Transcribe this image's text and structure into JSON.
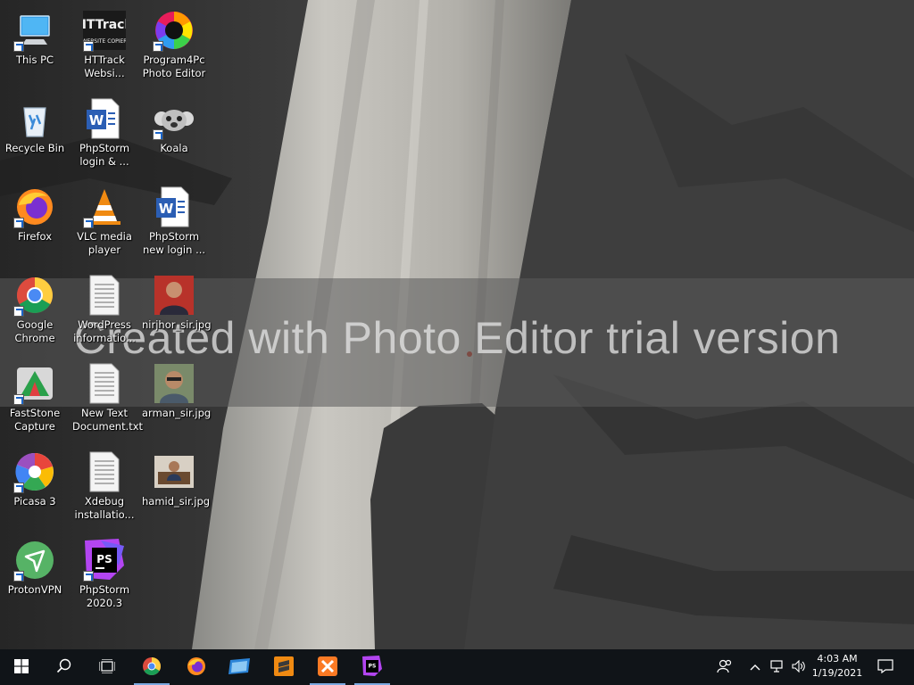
{
  "desktop": {
    "icons": [
      {
        "label": "This PC",
        "icon": "computer-icon"
      },
      {
        "label": "HTTrack Websi...",
        "icon": "httrack-icon",
        "logo_text": "HTTrack WEBSITE COPIER"
      },
      {
        "label": "Program4Pc Photo Editor",
        "icon": "photo-editor-icon"
      },
      {
        "label": "Recycle Bin",
        "icon": "recycle-bin-icon"
      },
      {
        "label": "PhpStorm login & ...",
        "icon": "word-document-icon"
      },
      {
        "label": "Koala",
        "icon": "koala-icon"
      },
      {
        "label": "Firefox",
        "icon": "firefox-icon"
      },
      {
        "label": "VLC media player",
        "icon": "vlc-icon"
      },
      {
        "label": "PhpStorm new login ...",
        "icon": "word-document-icon"
      },
      {
        "label": "Google Chrome",
        "icon": "chrome-icon"
      },
      {
        "label": "WordPress informatio...",
        "icon": "text-file-icon"
      },
      {
        "label": "nirjhor_sir.jpg",
        "icon": "photo-thumbnail-icon"
      },
      {
        "label": "FastStone Capture",
        "icon": "faststone-icon"
      },
      {
        "label": "New Text Document.txt",
        "icon": "text-file-icon"
      },
      {
        "label": "arman_sir.jpg",
        "icon": "photo-thumbnail-icon"
      },
      {
        "label": "Picasa 3",
        "icon": "picasa-icon"
      },
      {
        "label": "Xdebug installatio...",
        "icon": "text-file-icon"
      },
      {
        "label": "hamid_sir.jpg",
        "icon": "photo-thumbnail-icon"
      },
      {
        "label": "ProtonVPN",
        "icon": "protonvpn-icon"
      },
      {
        "label": "PhpStorm 2020.3",
        "icon": "phpstorm-icon",
        "logo_text": "PS"
      }
    ]
  },
  "watermark": {
    "text": "Created with Photo Editor trial version"
  },
  "taskbar": {
    "items": [
      {
        "name": "start",
        "icon": "windows-logo-icon"
      },
      {
        "name": "search",
        "icon": "search-icon"
      },
      {
        "name": "task-view",
        "icon": "task-view-icon"
      },
      {
        "name": "chrome",
        "icon": "chrome-icon"
      },
      {
        "name": "firefox",
        "icon": "firefox-icon"
      },
      {
        "name": "file-explorer",
        "icon": "folder-icon"
      },
      {
        "name": "sublime-text",
        "icon": "sublime-text-icon"
      },
      {
        "name": "xampp",
        "icon": "xampp-icon"
      },
      {
        "name": "phpstorm",
        "icon": "phpstorm-icon",
        "logo_text": "PS"
      }
    ],
    "tray": {
      "time": "4:03 AM",
      "date": "1/19/2021",
      "icons": [
        "people-icon",
        "chevron-up-icon",
        "network-icon",
        "volume-icon",
        "notification-icon"
      ]
    }
  },
  "colors": {
    "taskbar_bg": "#101418",
    "active_indicator": "#7aa8e0",
    "watermark_band": "rgba(90,90,90,0.55)"
  }
}
